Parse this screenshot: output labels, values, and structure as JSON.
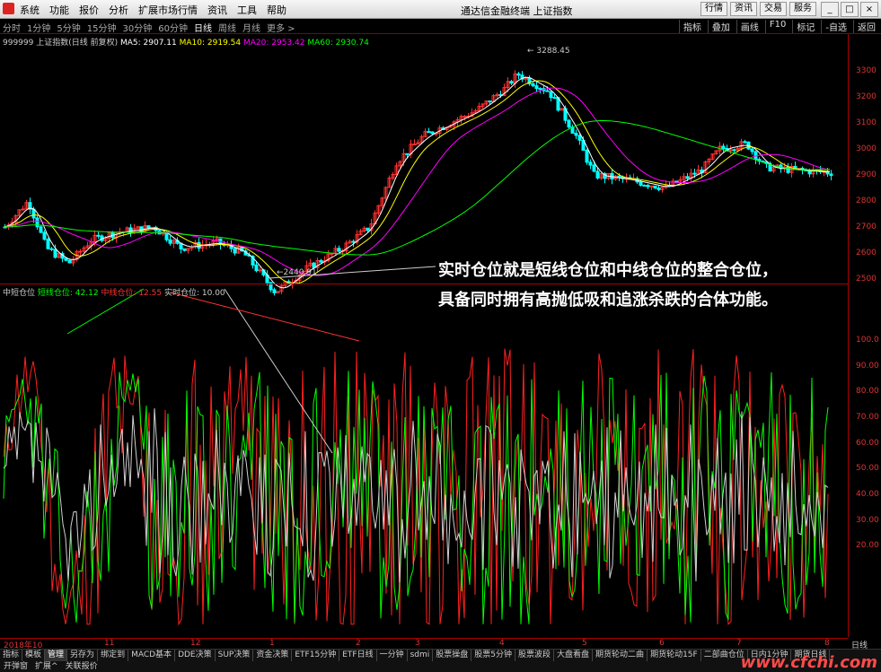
{
  "menu": [
    "系统",
    "功能",
    "报价",
    "分析",
    "扩展市场行情",
    "资讯",
    "工具",
    "帮助"
  ],
  "window_title": "通达信金融终端  上证指数",
  "title_buttons": [
    "行情",
    "资讯",
    "交易",
    "服务"
  ],
  "periods": [
    "分时",
    "1分钟",
    "5分钟",
    "15分钟",
    "30分钟",
    "60分钟",
    "日线",
    "周线",
    "月线",
    "更多 >"
  ],
  "active_period": "日线",
  "toolbar_right": [
    "指标",
    "叠加",
    "画线",
    "F10",
    "标记",
    "-自选",
    "返回"
  ],
  "legend": {
    "symbol": "999999 上证指数(日线 前复权)",
    "ma5": "MA5: 2907.11",
    "ma10": "MA10: 2919.54",
    "ma20": "MA20: 2953.42",
    "ma60": "MA60: 2930.74"
  },
  "price_high_label": "3288.45",
  "price_low_label": "2440.91",
  "price_axis": [
    "3300",
    "3200",
    "3100",
    "3000",
    "2900",
    "2800",
    "2700",
    "2600",
    "2500"
  ],
  "indicator_legend": {
    "name": "中短仓位",
    "short": "短线仓位: 42.12",
    "mid": "中线仓位: 12.55",
    "real": "实时仓位: 10.00"
  },
  "indicator_axis": [
    "100.0",
    "90.00",
    "80.00",
    "70.00",
    "60.00",
    "50.00",
    "40.00",
    "30.00",
    "20.00"
  ],
  "annotation": {
    "line1": "实时仓位就是短线仓位和中线仓位的整合仓位，",
    "line2": "具备同时拥有高抛低吸和追涨杀跌的合体功能。"
  },
  "x_axis": [
    "2018年10",
    "11",
    "12",
    "1",
    "2",
    "3",
    "4",
    "5",
    "6",
    "7",
    "8"
  ],
  "x_axis_right": "日线",
  "tabs": [
    "指标",
    "模板",
    "管理",
    "另存为",
    "绑定到",
    "MACD基本",
    "DDE决策",
    "SUP决策",
    "资金决策",
    "ETF15分钟",
    "ETF日线",
    "一分钟",
    "sdmi",
    "股票操盘",
    "股票5分钟",
    "股票波段",
    "大盘看盘",
    "期货轮动二曲",
    "期货轮动15F",
    "二部曲仓位",
    "日内1分钟",
    "期货日线"
  ],
  "active_tab": "管理",
  "status": [
    "开弹窗",
    "扩展^",
    "关联报价"
  ],
  "watermark": "www.cfchi.com",
  "colors": {
    "ma5": "#ffffff",
    "ma10": "#ffff00",
    "ma20": "#ff00ff",
    "ma60": "#00ff00",
    "short": "#00ff00",
    "mid": "#ff2020",
    "real": "#d0d0d0",
    "up": "#ff3030",
    "down": "#00ffff"
  }
}
